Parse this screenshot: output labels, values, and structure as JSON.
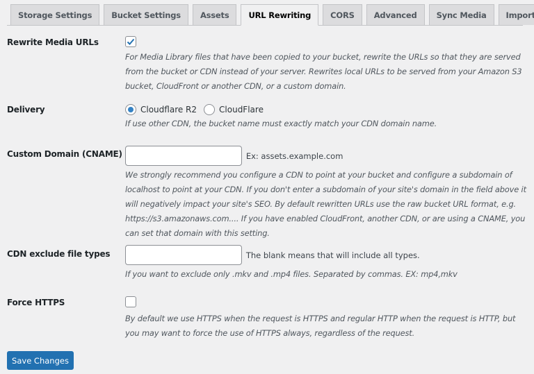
{
  "tabs": [
    {
      "label": "Storage Settings",
      "active": false
    },
    {
      "label": "Bucket Settings",
      "active": false
    },
    {
      "label": "Assets",
      "active": false
    },
    {
      "label": "URL Rewriting",
      "active": true
    },
    {
      "label": "CORS",
      "active": false
    },
    {
      "label": "Advanced",
      "active": false
    },
    {
      "label": "Sync Media",
      "active": false
    },
    {
      "label": "Import/Export settings",
      "active": false
    }
  ],
  "settings": {
    "rewrite_media_urls": {
      "label": "Rewrite Media URLs",
      "checked": true,
      "description": "For Media Library files that have been copied to your bucket, rewrite the URLs so that they are served from the bucket or CDN instead of your server. Rewrites local URLs to be served from your Amazon S3 bucket, CloudFront or another CDN, or a custom domain."
    },
    "delivery": {
      "label": "Delivery",
      "options": [
        {
          "label": "Cloudflare R2",
          "selected": true
        },
        {
          "label": "CloudFlare",
          "selected": false
        }
      ],
      "description": "If use other CDN, the bucket name must exactly match your CDN domain name."
    },
    "custom_domain": {
      "label": "Custom Domain (CNAME)",
      "value": "",
      "note": "Ex: assets.example.com",
      "description": "We strongly recommend you configure a CDN to point at your bucket and configure a subdomain of localhost to point at your CDN. If you don't enter a subdomain of your site's domain in the field above it will negatively impact your site's SEO. By default rewritten URLs use the raw bucket URL format, e.g. https://s3.amazonaws.com.... If you have enabled CloudFront, another CDN, or are using a CNAME, you can set that domain with this setting."
    },
    "cdn_exclude": {
      "label": "CDN exclude file types",
      "value": "",
      "note": "The blank means that will include all types.",
      "description": "If you want to exclude only .mkv and .mp4 files. Separated by commas. EX: mp4,mkv"
    },
    "force_https": {
      "label": "Force HTTPS",
      "checked": false,
      "description": "By default we use HTTPS when the request is HTTPS and regular HTTP when the request is HTTP, but you may want to force the use of HTTPS always, regardless of the request."
    }
  },
  "save_button": {
    "label": "Save Changes"
  },
  "colors": {
    "accent": "#2271b1",
    "background": "#f0f0f1"
  }
}
